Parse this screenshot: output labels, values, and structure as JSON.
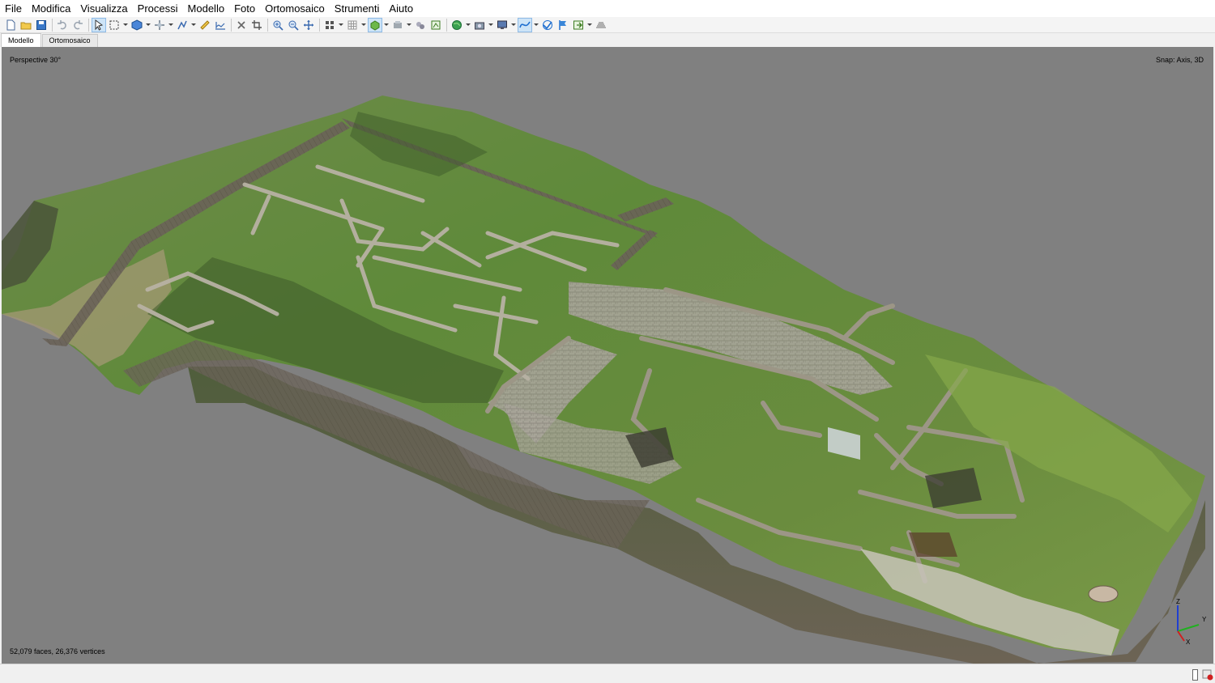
{
  "menu": {
    "items": [
      "File",
      "Modifica",
      "Visualizza",
      "Processi",
      "Modello",
      "Foto",
      "Ortomosaico",
      "Strumenti",
      "Aiuto"
    ]
  },
  "tabs": [
    {
      "label": "Modello",
      "active": true
    },
    {
      "label": "Ortomosaico",
      "active": false
    }
  ],
  "viewport": {
    "projection_label": "Perspective 30°",
    "snap_label": "Snap: Axis, 3D",
    "stats_label": "52,079 faces, 26,376 vertices",
    "axis_labels": {
      "z": "Z",
      "y": "Y",
      "x": "X"
    },
    "background_color": "#808080"
  },
  "toolbar": {
    "icons": [
      "new-icon",
      "open-icon",
      "save-icon",
      "undo-icon",
      "redo-icon",
      "navigation-icon",
      "rectangle-selection-icon",
      "model-view-icon",
      "transform-object-icon",
      "draw-polyline-icon",
      "ruler-icon",
      "measure-profile-icon",
      "delete-selection-icon",
      "crop-selection-icon",
      "zoom-in-icon",
      "zoom-out-icon",
      "reset-view-icon",
      "show-cameras-icon",
      "show-grid-icon",
      "model-textured-icon",
      "dense-cloud-icon",
      "show-markers-icon",
      "show-shapes-icon",
      "globe-icon",
      "capture-view-icon",
      "screen-icon",
      "curve-icon",
      "heal-icon",
      "flag-icon",
      "export-icon",
      "stack-icon"
    ]
  },
  "colors": {
    "accent": "#1f6fd0",
    "axis_x": "#d02020",
    "axis_y": "#20b020",
    "axis_z": "#2040d0"
  }
}
